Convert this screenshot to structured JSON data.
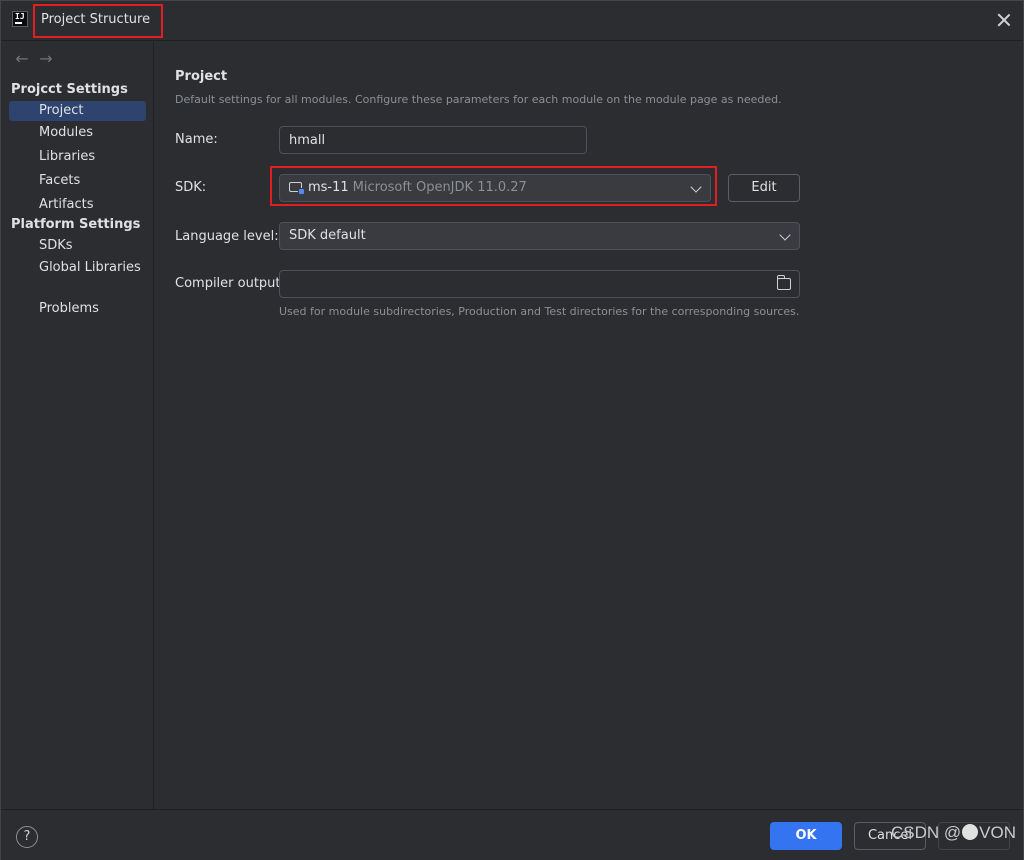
{
  "window": {
    "title": "Project Structure",
    "app_icon": "intellij-icon",
    "app_icon_text": "IJ"
  },
  "nav": {
    "back_glyph": "←",
    "forward_glyph": "→"
  },
  "sidebar": {
    "project_settings_heading": "Projcct Settings",
    "platform_settings_heading": "Platform Settings",
    "items": {
      "project": "Project",
      "modules": "Modules",
      "libraries": "Libraries",
      "facets": "Facets",
      "artifacts": "Artifacts",
      "sdks": "SDKs",
      "global_libraries": "Global Libraries",
      "problems": "Problems"
    },
    "selected": "Project"
  },
  "main": {
    "heading": "Project",
    "description": "Default settings for all modules. Configure these parameters for each module on the module page as needed.",
    "name_label": "Name:",
    "name_value": "hmall",
    "sdk_label": "SDK:",
    "sdk_name": "ms-11",
    "sdk_description": "Microsoft OpenJDK 11.0.27",
    "edit_button": "Edit",
    "language_level_label": "Language level:",
    "language_level_value": "SDK default",
    "compiler_output_label": "Compiler output:",
    "compiler_output_value": "",
    "compiler_output_hint": "Used for module subdirectories, Production and Test directories for the corresponding sources."
  },
  "footer": {
    "help_glyph": "?",
    "ok_label": "OK",
    "cancel_label": "Cancel"
  },
  "watermark": {
    "prefix": "CSDN @",
    "suffix": "VON"
  },
  "colors": {
    "background": "#2b2d30",
    "selection": "#2e436e",
    "accent": "#3574f0",
    "highlight_box": "#e02020"
  }
}
